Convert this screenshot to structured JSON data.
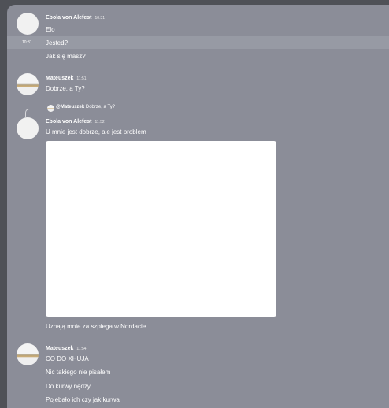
{
  "hover_time": "10:31",
  "messages": [
    {
      "author": "Ebola von Alefest",
      "time": "10:31",
      "lines": [
        "Elo",
        "Jested?",
        "Jak się masz?"
      ]
    },
    {
      "author": "Mateuszek",
      "time": "11:51",
      "lines": [
        "Dobrze, a Ty?"
      ]
    },
    {
      "reply_author": "@Mateuszek",
      "reply_text": "Dobrze, a Ty?",
      "author": "Ebola von Alefest",
      "time": "11:52",
      "lines": [
        "U mnie jest dobrze, ale jest problem"
      ],
      "caption": "Uznają mnie za szpiega w Nordacie"
    },
    {
      "author": "Mateuszek",
      "time": "11:54",
      "lines": [
        "CO DO XHUJA",
        "Nic takiego nie pisałem",
        "Do kurwy nędzy",
        "Pojebało ich czy jak kurwa"
      ]
    }
  ]
}
